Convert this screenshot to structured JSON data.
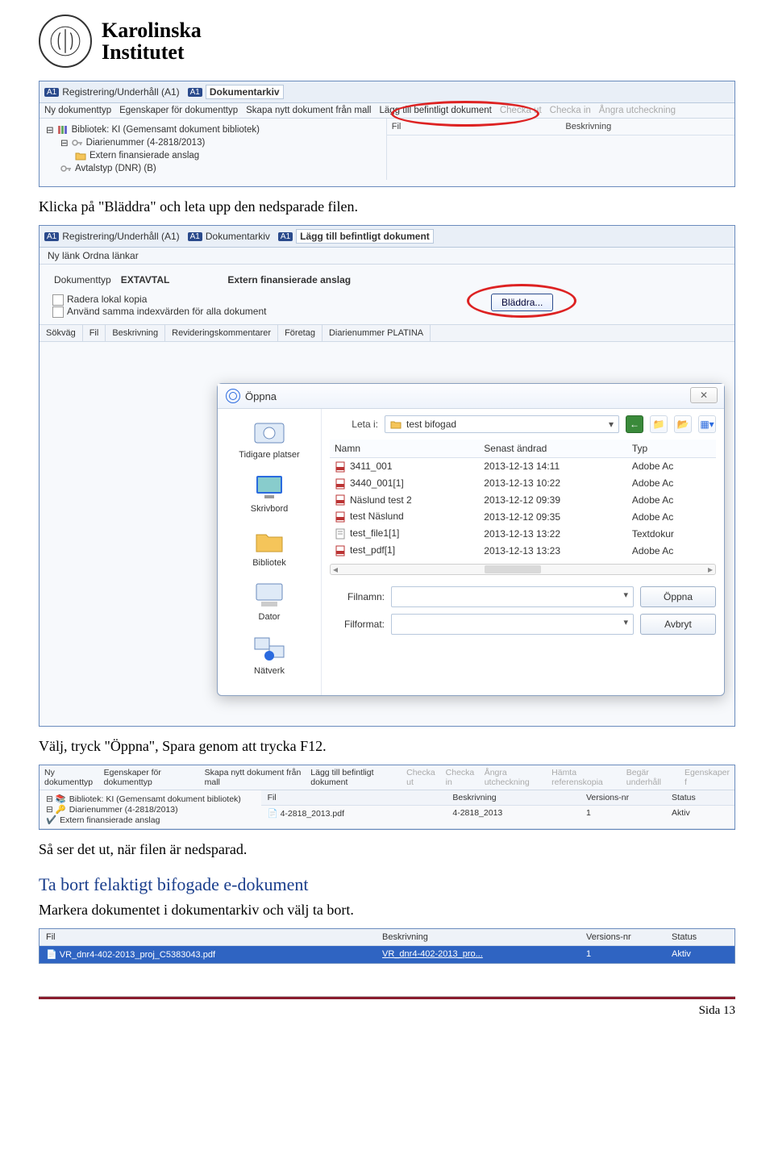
{
  "header": {
    "institution_line1": "Karolinska",
    "institution_line2": "Institutet"
  },
  "ss1": {
    "tabs": [
      {
        "badge": "A1",
        "label": "Registrering/Underhåll (A1)"
      },
      {
        "badge": "A1",
        "label": "Dokumentarkiv"
      }
    ],
    "menu": [
      "Ny dokumenttyp",
      "Egenskaper för dokumenttyp",
      "Skapa nytt dokument från mall",
      "Lägg till befintligt dokument",
      "Checka ut",
      "Checka in",
      "Ångra utcheckning"
    ],
    "tree": [
      "Bibliotek: KI (Gemensamt dokument bibliotek)",
      "Diarienummer (4-2818/2013)",
      "Extern finansierade anslag",
      "Avtalstyp (DNR) (B)"
    ],
    "cols": [
      "Fil",
      "Beskrivning"
    ]
  },
  "para1": "Klicka på \"Bläddra\" och leta upp den nedsparade filen.",
  "ss2": {
    "tabs": [
      "Registrering/Underhåll (A1)",
      "Dokumentarkiv",
      "Lägg till befintligt dokument"
    ],
    "subtoolbar": "Ny länk  Ordna länkar",
    "doc_type_label": "Dokumenttyp",
    "doc_type_value": "EXTAVTAL",
    "doc_type_desc": "Extern finansierade anslag",
    "chk1": "Radera lokal kopia",
    "chk2": "Använd samma indexvärden för alla dokument",
    "bladdra": "Bläddra...",
    "gridcols": [
      "Sökväg",
      "Fil",
      "Beskrivning",
      "Revideringskommentarer",
      "Företag",
      "Diarienummer PLATINA"
    ],
    "dialog": {
      "title": "Öppna",
      "close": "✕",
      "leta_label": "Leta i:",
      "leta_value": "test bifogad",
      "places": [
        "Tidigare platser",
        "Skrivbord",
        "Bibliotek",
        "Dator",
        "Nätverk"
      ],
      "cols": [
        "Namn",
        "Senast ändrad",
        "Typ"
      ],
      "rows": [
        {
          "name": "3411_001",
          "date": "2013-12-13 14:11",
          "type": "Adobe Ac",
          "icon": "pdf"
        },
        {
          "name": "3440_001[1]",
          "date": "2013-12-13 10:22",
          "type": "Adobe Ac",
          "icon": "pdf"
        },
        {
          "name": "Näslund test 2",
          "date": "2013-12-12 09:39",
          "type": "Adobe Ac",
          "icon": "pdf"
        },
        {
          "name": "test Näslund",
          "date": "2013-12-12 09:35",
          "type": "Adobe Ac",
          "icon": "pdf"
        },
        {
          "name": "test_file1[1]",
          "date": "2013-12-13 13:22",
          "type": "Textdokur",
          "icon": "txt"
        },
        {
          "name": "test_pdf[1]",
          "date": "2013-12-13 13:23",
          "type": "Adobe Ac",
          "icon": "pdf"
        }
      ],
      "filnamn_label": "Filnamn:",
      "filformat_label": "Filformat:",
      "open_btn": "Öppna",
      "cancel_btn": "Avbryt"
    }
  },
  "para2": "Välj, tryck \"Öppna\", Spara genom att trycka F12.",
  "ss3": {
    "menu": [
      "Ny dokumenttyp",
      "Egenskaper för dokumenttyp",
      "Skapa nytt dokument från mall",
      "Lägg till befintligt dokument",
      "Checka ut",
      "Checka in",
      "Ångra utcheckning",
      "Hämta referenskopia",
      "Begär underhåll",
      "Egenskaper f"
    ],
    "tree": [
      "Bibliotek: KI (Gemensamt dokument bibliotek)",
      "Diarienummer (4-2818/2013)",
      "Extern finansierade anslag"
    ],
    "cols": [
      "Fil",
      "Beskrivning",
      "Versions-nr",
      "Status"
    ],
    "row": {
      "fil": "4-2818_2013.pdf",
      "besk": "4-2818_2013",
      "ver": "1",
      "status": "Aktiv"
    }
  },
  "para3": "Så ser det ut, när filen är nedsparad.",
  "heading2": "Ta bort felaktigt bifogade e-dokument",
  "para4": "Markera dokumentet i dokumentarkiv och välj ta bort.",
  "ss4": {
    "cols": [
      "Fil",
      "Beskrivning",
      "Versions-nr",
      "Status"
    ],
    "row": {
      "fil": "VR_dnr4-402-2013_proj_C5383043.pdf",
      "besk": "VR_dnr4-402-2013_pro...",
      "ver": "1",
      "status": "Aktiv"
    }
  },
  "page_number": "Sida 13"
}
